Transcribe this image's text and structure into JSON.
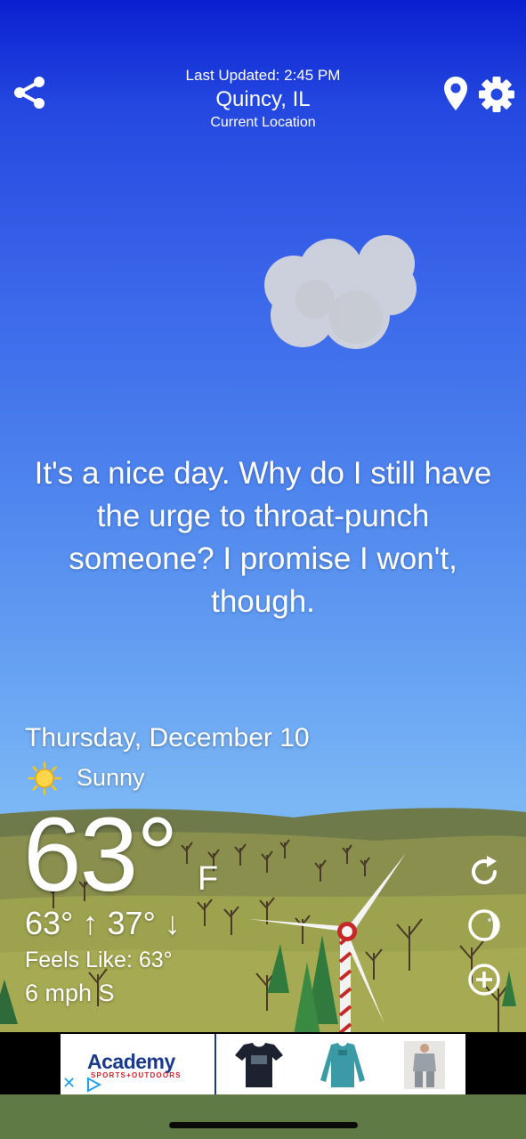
{
  "header": {
    "last_updated": "Last Updated: 2:45 PM",
    "city": "Quincy, IL",
    "location_label": "Current Location",
    "icons": [
      "share-icon",
      "location-pin-icon",
      "gear-icon"
    ]
  },
  "quote": "It's a nice day. Why do I still have the urge to throat-punch someone? I promise I won't, though.",
  "weather": {
    "date": "Thursday, December 10",
    "condition": "Sunny",
    "temperature": "63°",
    "unit": "F",
    "high_low": "63° ↑ 37° ↓",
    "feels_like": "Feels Like: 63°",
    "wind": "6 mph S"
  },
  "side_buttons": [
    "refresh-icon",
    "moon-phase-icon",
    "add-icon"
  ],
  "ad": {
    "brand": "Academy",
    "tagline": "SPORTS+OUTDOORS",
    "close": "✕",
    "products": [
      "navy-tshirt",
      "teal-long-sleeve-shirt",
      "gray-sweatsuit"
    ]
  },
  "colors": {
    "sky_top": "#0a1fd0",
    "sky_bottom": "#7bb6f5",
    "ground": "#7a8a44",
    "ad_brand": "#1a3a8c",
    "ad_accent": "#d4202b"
  }
}
